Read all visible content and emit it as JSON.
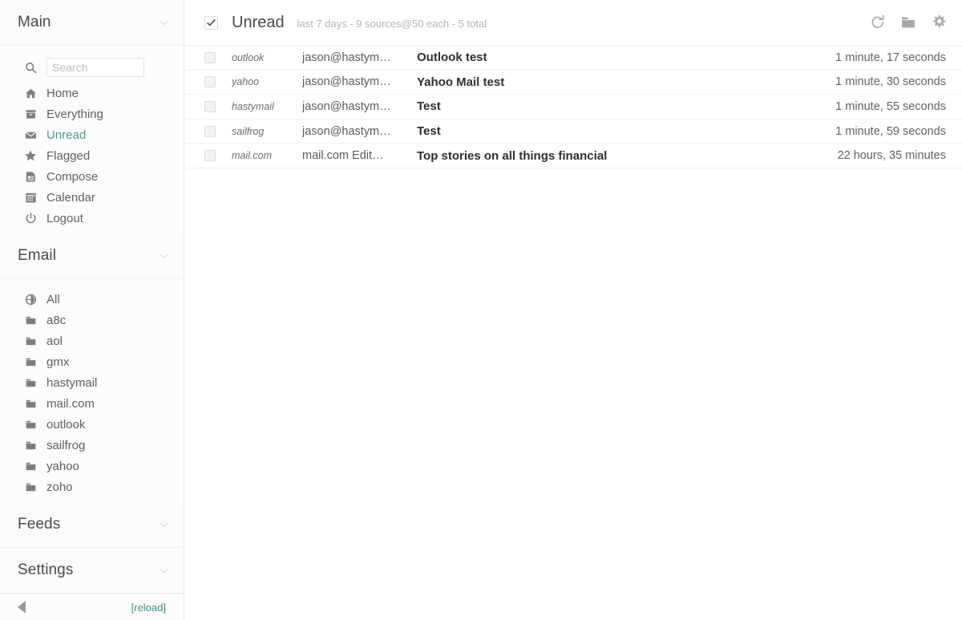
{
  "sidebar": {
    "sections": [
      {
        "id": "main",
        "title": "Main",
        "chevron_icon": "chevron-down-icon",
        "search": {
          "placeholder": "Search",
          "value": "",
          "icon": "search-icon"
        },
        "items": [
          {
            "label": "Home",
            "icon": "home-icon",
            "active": false
          },
          {
            "label": "Everything",
            "icon": "archive-icon",
            "active": false
          },
          {
            "label": "Unread",
            "icon": "envelope-icon",
            "active": true
          },
          {
            "label": "Flagged",
            "icon": "star-icon",
            "active": false
          },
          {
            "label": "Compose",
            "icon": "compose-icon",
            "active": false
          },
          {
            "label": "Calendar",
            "icon": "calendar-icon",
            "active": false
          },
          {
            "label": "Logout",
            "icon": "power-icon",
            "active": false
          }
        ]
      },
      {
        "id": "email",
        "title": "Email",
        "chevron_icon": "chevron-down-icon",
        "items": [
          {
            "label": "All",
            "icon": "globe-icon",
            "active": false
          },
          {
            "label": "a8c",
            "icon": "folder-icon",
            "active": false
          },
          {
            "label": "aol",
            "icon": "folder-icon",
            "active": false
          },
          {
            "label": "gmx",
            "icon": "folder-icon",
            "active": false
          },
          {
            "label": "hastymail",
            "icon": "folder-icon",
            "active": false
          },
          {
            "label": "mail.com",
            "icon": "folder-icon",
            "active": false
          },
          {
            "label": "outlook",
            "icon": "folder-icon",
            "active": false
          },
          {
            "label": "sailfrog",
            "icon": "folder-icon",
            "active": false
          },
          {
            "label": "yahoo",
            "icon": "folder-icon",
            "active": false
          },
          {
            "label": "zoho",
            "icon": "folder-icon",
            "active": false
          }
        ]
      },
      {
        "id": "feeds",
        "title": "Feeds",
        "chevron_icon": "chevron-down-icon",
        "items": []
      },
      {
        "id": "settings",
        "title": "Settings",
        "chevron_icon": "chevron-down-icon",
        "items": []
      }
    ],
    "footer": {
      "collapse_icon": "collapse-left-icon",
      "reload_label": "[reload]"
    }
  },
  "header": {
    "select_all_checked": true,
    "select_all_icon": "checkmark-icon",
    "title": "Unread",
    "subtitle": "last 7 days - 9 sources@50 each - 5 total",
    "tools": [
      {
        "name": "refresh-icon",
        "label": "Refresh"
      },
      {
        "name": "folder-icon",
        "label": "Folders"
      },
      {
        "name": "gear-icon",
        "label": "Settings"
      }
    ]
  },
  "messages": [
    {
      "checked": false,
      "source": "outlook",
      "from": "jason@hastym…",
      "subject": "Outlook test",
      "time": "1 minute, 17 seconds"
    },
    {
      "checked": false,
      "source": "yahoo",
      "from": "jason@hastym…",
      "subject": "Yahoo Mail test",
      "time": "1 minute, 30 seconds"
    },
    {
      "checked": false,
      "source": "hastymail",
      "from": "jason@hastym…",
      "subject": "Test",
      "time": "1 minute, 55 seconds"
    },
    {
      "checked": false,
      "source": "sailfrog",
      "from": "jason@hastym…",
      "subject": "Test",
      "time": "1 minute, 59 seconds"
    },
    {
      "checked": false,
      "source": "mail.com",
      "from": "mail.com Edit…",
      "subject": "Top stories on all things financial",
      "time": "22 hours, 35 minutes"
    }
  ],
  "colors": {
    "accent": "#4a9b8e",
    "link": "#3f8f84",
    "icon_gray": "#7d7d7d",
    "text": "#4a4a4a",
    "muted": "#b4b4b4"
  }
}
